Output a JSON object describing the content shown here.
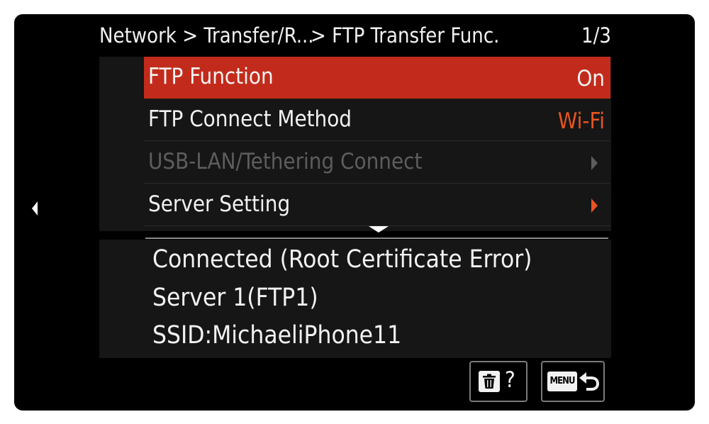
{
  "header": {
    "breadcrumb_part1": "Network > Transfer/R...",
    "breadcrumb_part2": "> FTP Transfer Func.",
    "page_indicator": "1/3"
  },
  "menu": {
    "items": [
      {
        "label": "FTP Function",
        "value": "On",
        "state": "selected"
      },
      {
        "label": "FTP Connect Method",
        "value": "Wi-Fi",
        "state": "normal"
      },
      {
        "label": "USB-LAN/Tethering Connect",
        "value": "",
        "state": "disabled",
        "icon": "chevron-right-icon"
      },
      {
        "label": "Server Setting",
        "value": "",
        "state": "normal",
        "icon": "chevron-right-icon"
      }
    ]
  },
  "info": {
    "status": "Connected (Root Certificate Error)",
    "server": "Server 1(FTP1)",
    "ssid": "SSID:MichaeliPhone11"
  },
  "buttons": {
    "help_symbol": "?",
    "menu_label": "MENU"
  },
  "colors": {
    "selected_bg": "#c22b1b",
    "accent_orange": "#e8541f",
    "disabled_text": "#5d5d5d",
    "text": "#f2f2f2"
  }
}
